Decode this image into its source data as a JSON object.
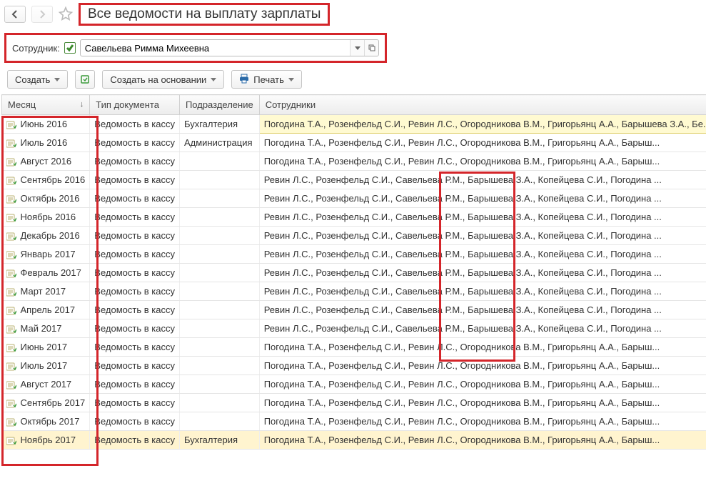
{
  "title": "Все ведомости на выплату зарплаты",
  "filter": {
    "label": "Сотрудник:",
    "value": "Савельева Римма Михеевна"
  },
  "toolbar": {
    "create": "Создать",
    "create_on_basis": "Создать на основании",
    "print": "Печать"
  },
  "columns": {
    "month": "Месяц",
    "doctype": "Тип документа",
    "dept": "Подразделение",
    "employees": "Сотрудники"
  },
  "tooltip_employees": "Погодина Т.А., Розенфельд С.И., Ревин Л.С., Огородникова В.М., Григорьянц А.А., Барышева З.А., Бе...",
  "rows": [
    {
      "month": "Июнь 2016",
      "doctype": "Ведомость в кассу",
      "dept": "Бухгалтерия",
      "employees": "Погодина Т.А., Розенфельд С.И., Ревин Л.С., Огородникова В.М., Григорьянц А.А., Барыш..."
    },
    {
      "month": "Июль 2016",
      "doctype": "Ведомость в кассу",
      "dept": "Администрация",
      "employees": "Погодина Т.А., Розенфельд С.И., Ревин Л.С., Огородникова В.М., Григорьянц А.А., Барыш..."
    },
    {
      "month": "Август 2016",
      "doctype": "Ведомость в кассу",
      "dept": "",
      "employees": "Погодина Т.А., Розенфельд С.И., Ревин Л.С., Огородникова В.М., Григорьянц А.А., Барыш..."
    },
    {
      "month": "Сентябрь 2016",
      "doctype": "Ведомость в кассу",
      "dept": "",
      "employees": "Ревин Л.С., Розенфельд С.И., Савельева Р.М., Барышева З.А., Копейцева С.И., Погодина ..."
    },
    {
      "month": "Октябрь 2016",
      "doctype": "Ведомость в кассу",
      "dept": "",
      "employees": "Ревин Л.С., Розенфельд С.И., Савельева Р.М., Барышева З.А., Копейцева С.И., Погодина ..."
    },
    {
      "month": "Ноябрь 2016",
      "doctype": "Ведомость в кассу",
      "dept": "",
      "employees": "Ревин Л.С., Розенфельд С.И., Савельева Р.М., Барышева З.А., Копейцева С.И., Погодина ..."
    },
    {
      "month": "Декабрь 2016",
      "doctype": "Ведомость в кассу",
      "dept": "",
      "employees": "Ревин Л.С., Розенфельд С.И., Савельева Р.М., Барышева З.А., Копейцева С.И., Погодина ..."
    },
    {
      "month": "Январь 2017",
      "doctype": "Ведомость в кассу",
      "dept": "",
      "employees": "Ревин Л.С., Розенфельд С.И., Савельева Р.М., Барышева З.А., Копейцева С.И., Погодина ..."
    },
    {
      "month": "Февраль 2017",
      "doctype": "Ведомость в кассу",
      "dept": "",
      "employees": "Ревин Л.С., Розенфельд С.И., Савельева Р.М., Барышева З.А., Копейцева С.И., Погодина ..."
    },
    {
      "month": "Март 2017",
      "doctype": "Ведомость в кассу",
      "dept": "",
      "employees": "Ревин Л.С., Розенфельд С.И., Савельева Р.М., Барышева З.А., Копейцева С.И., Погодина ..."
    },
    {
      "month": "Апрель 2017",
      "doctype": "Ведомость в кассу",
      "dept": "",
      "employees": "Ревин Л.С., Розенфельд С.И., Савельева Р.М., Барышева З.А., Копейцева С.И., Погодина ..."
    },
    {
      "month": "Май 2017",
      "doctype": "Ведомость в кассу",
      "dept": "",
      "employees": "Ревин Л.С., Розенфельд С.И., Савельева Р.М., Барышева З.А., Копейцева С.И., Погодина ..."
    },
    {
      "month": "Июнь 2017",
      "doctype": "Ведомость в кассу",
      "dept": "",
      "employees": "Погодина Т.А., Розенфельд С.И., Ревин Л.С., Огородникова В.М., Григорьянц А.А., Барыш..."
    },
    {
      "month": "Июль 2017",
      "doctype": "Ведомость в кассу",
      "dept": "",
      "employees": "Погодина Т.А., Розенфельд С.И., Ревин Л.С., Огородникова В.М., Григорьянц А.А., Барыш..."
    },
    {
      "month": "Август 2017",
      "doctype": "Ведомость в кассу",
      "dept": "",
      "employees": "Погодина Т.А., Розенфельд С.И., Ревин Л.С., Огородникова В.М., Григорьянц А.А., Барыш..."
    },
    {
      "month": "Сентябрь 2017",
      "doctype": "Ведомость в кассу",
      "dept": "",
      "employees": "Погодина Т.А., Розенфельд С.И., Ревин Л.С., Огородникова В.М., Григорьянц А.А., Барыш..."
    },
    {
      "month": "Октябрь 2017",
      "doctype": "Ведомость в кассу",
      "dept": "",
      "employees": "Погодина Т.А., Розенфельд С.И., Ревин Л.С., Огородникова В.М., Григорьянц А.А., Барыш..."
    },
    {
      "month": "Ноябрь 2017",
      "doctype": "Ведомость в кассу",
      "dept": "Бухгалтерия",
      "employees": "Погодина Т.А., Розенфельд С.И., Ревин Л.С., Огородникова В.М., Григорьянц А.А., Барыш..."
    }
  ],
  "selected_row_index": 17
}
